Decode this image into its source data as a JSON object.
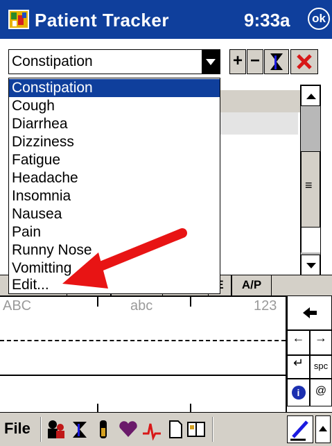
{
  "titlebar": {
    "title": "Patient Tracker",
    "clock": "9:33a",
    "ok": "ok"
  },
  "combo": {
    "value": "Constipation"
  },
  "toolbar": {
    "plus": "+",
    "minus": "−"
  },
  "dropdown": {
    "items": [
      "Constipation",
      "Cough",
      "Diarrhea",
      "Dizziness",
      "Fatigue",
      "Headache",
      "Insomnia",
      "Nausea",
      "Pain",
      "Runny Nose",
      "Vomitting",
      "Edit..."
    ],
    "selected": "Constipation"
  },
  "tabs": {
    "ap": "A/P",
    "partial": "E"
  },
  "input_panel": {
    "abc_upper": "ABC",
    "abc_lower": "abc",
    "numbers": "123"
  },
  "keys": {
    "space": "spc",
    "info": "i",
    "at": "@"
  },
  "bottombar": {
    "file": "File"
  },
  "colors": {
    "titlebar": "#0f3f9c",
    "selection": "#0f3f9c",
    "arrow": "#e81414",
    "chrome": "#d4d0c8"
  }
}
